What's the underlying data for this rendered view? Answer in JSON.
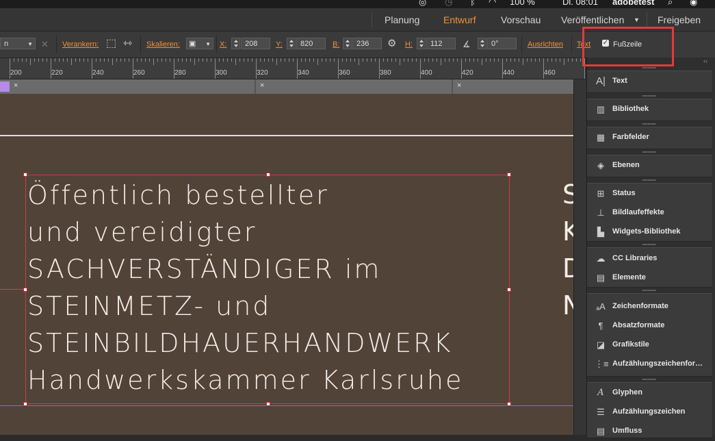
{
  "menubar": {
    "battery": "100 %",
    "clock": "Di. 08:01",
    "user": "adobetest"
  },
  "workspace": {
    "items": [
      {
        "label": "Planung"
      },
      {
        "label": "Entwurf",
        "active": true
      },
      {
        "label": "Vorschau"
      },
      {
        "label": "Veröffentlichen",
        "dropdown": true
      },
      {
        "label": "Freigeben"
      }
    ]
  },
  "control": {
    "dropdown_value": "n",
    "anchor_label": "Verankern:",
    "scale_label": "Skalieren:",
    "x_label": "X:",
    "x_value": "208",
    "y_label": "Y:",
    "y_value": "820",
    "w_label": "B:",
    "w_value": "236",
    "h_label": "H:",
    "h_value": "112",
    "angle_value": "0°",
    "align_label": "Ausrichten",
    "text_label": "Text",
    "footer_checkbox": {
      "label": "Fußzeile",
      "checked": true
    }
  },
  "ruler": {
    "marks": [
      "200",
      "220",
      "240",
      "260",
      "280",
      "300",
      "320",
      "340",
      "360",
      "380",
      "400",
      "420",
      "440",
      "460"
    ]
  },
  "document": {
    "heading_lines": [
      "Öffentlich bestellter",
      "und vereidigter",
      "SACHVERSTÄNDIGER im",
      "STEINMETZ- und",
      "STEINBILDHAUERHANDWERK",
      "Handwerkskammer Karlsruhe"
    ],
    "right_column_initials": [
      "S",
      "K",
      "D",
      "N"
    ]
  },
  "panel": {
    "groups": [
      [
        {
          "label": "Text",
          "icon": "text-icon"
        }
      ],
      [
        {
          "label": "Bibliothek",
          "icon": "library-icon"
        }
      ],
      [
        {
          "label": "Farbfelder",
          "icon": "swatches-icon"
        }
      ],
      [
        {
          "label": "Ebenen",
          "icon": "layers-icon"
        }
      ],
      [
        {
          "label": "Status",
          "icon": "status-icon"
        },
        {
          "label": "Bildlaufeffekte",
          "icon": "scroll-effects-icon"
        },
        {
          "label": "Widgets-Bibliothek",
          "icon": "widgets-icon"
        }
      ],
      [
        {
          "label": "CC Libraries",
          "icon": "cc-libraries-icon"
        },
        {
          "label": "Elemente",
          "icon": "assets-icon"
        }
      ],
      [
        {
          "label": "Zeichenformate",
          "icon": "character-styles-icon"
        },
        {
          "label": "Absatzformate",
          "icon": "paragraph-styles-icon"
        },
        {
          "label": "Grafikstile",
          "icon": "graphic-styles-icon"
        },
        {
          "label": "Aufzählungszeichenfor…",
          "icon": "bullet-styles-icon"
        }
      ],
      [
        {
          "label": "Glyphen",
          "icon": "glyphs-icon"
        },
        {
          "label": "Aufzählungszeichen",
          "icon": "bullets-icon"
        },
        {
          "label": "Umfluss",
          "icon": "text-wrap-icon"
        }
      ]
    ]
  },
  "colors": {
    "accent": "#f0923a",
    "highlight": "#e23b3b",
    "canvas": "#524339"
  }
}
